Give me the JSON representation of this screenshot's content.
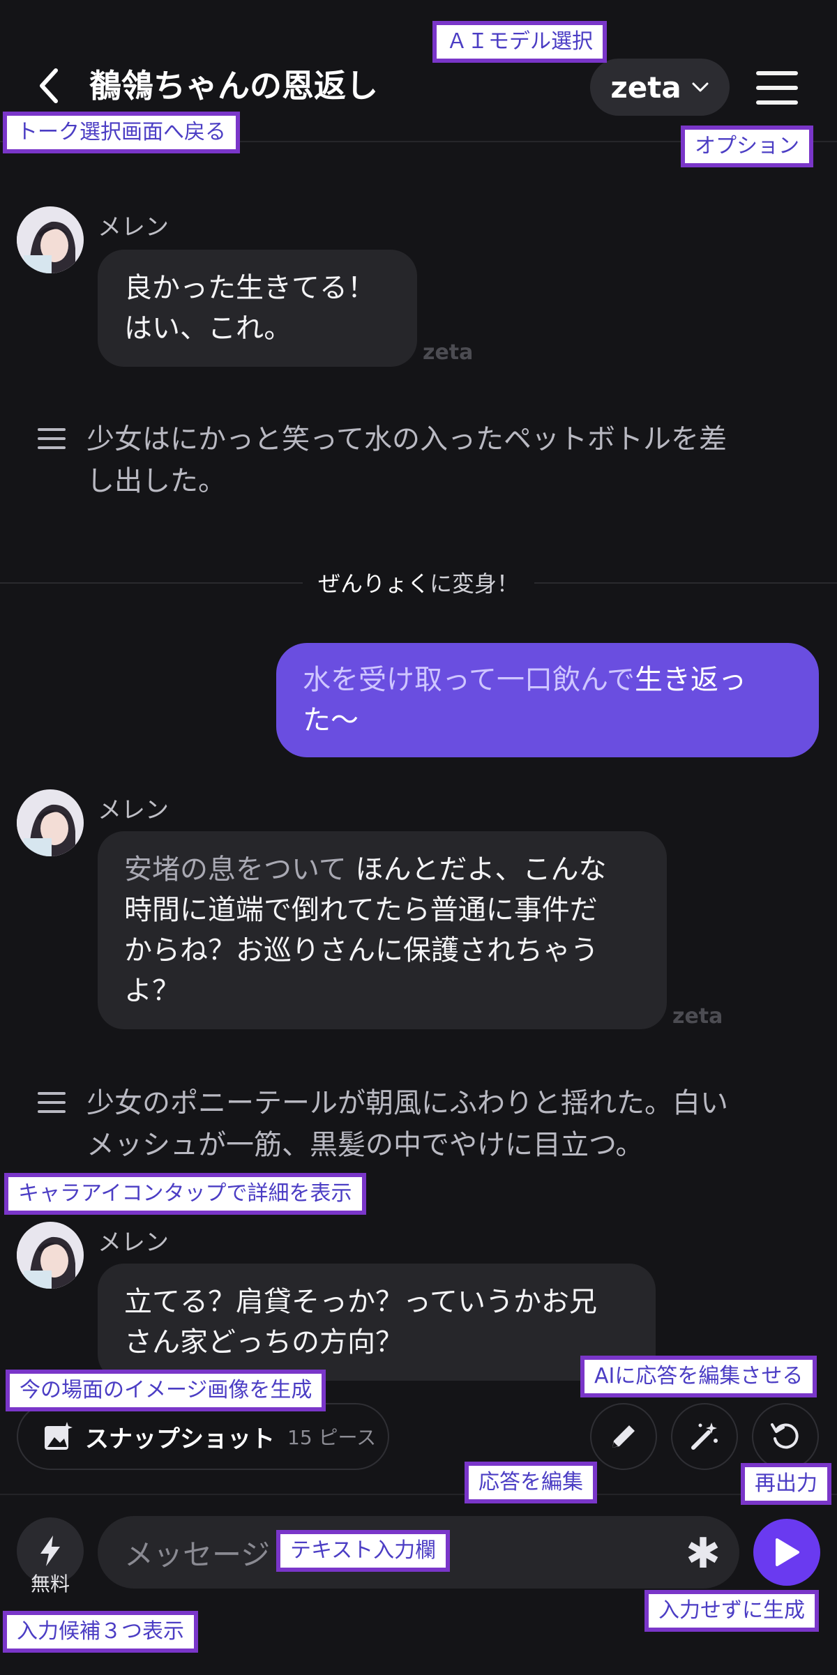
{
  "header": {
    "title": "鶺鴒ちゃんの恩返し",
    "model_label": "zeta"
  },
  "messages": [
    {
      "speaker": "メレン",
      "lines": [
        "良かった生きてる！",
        "はい、これ。"
      ],
      "watermark": "zeta"
    },
    {
      "narration": [
        "少女はにかっと笑って水の入ったペットボトルを差",
        "し出した。"
      ]
    },
    {
      "transform": {
        "highlight": "ぜんりょく",
        "rest": "に変身！"
      }
    },
    {
      "user": {
        "action_part": "水を受け取って一口飲んで",
        "speech_part": "生き返っ",
        "line2": "た〜"
      }
    },
    {
      "speaker": "メレン",
      "action": "安堵の息をついて",
      "speech_first": "ほんとだよ、こんな",
      "lines": [
        "時間に道端で倒れてたら普通に事件だ",
        "からね？お巡りさんに保護されちゃう",
        "よ？"
      ],
      "watermark": "zeta"
    },
    {
      "narration": [
        "少女のポニーテールが朝風にふわりと揺れた。白い",
        "メッシュが一筋、黒髪の中でやけに目立つ。"
      ]
    },
    {
      "speaker": "メレン",
      "lines": [
        "立てる？肩貸そっか？っていうかお兄",
        "さん家どっちの方向？"
      ]
    }
  ],
  "tools": {
    "snapshot_label": "スナップショット",
    "snapshot_count": "15 ピース"
  },
  "input": {
    "free_label": "無料",
    "placeholder": "メッセージ"
  },
  "callouts": {
    "model_select": "ＡＩモデル選択",
    "back": "トーク選択画面へ戻る",
    "options": "オプション",
    "avatar_tap": "キャラアイコンタップで詳細を表示",
    "snapshot": "今の場面のイメージ画像を生成",
    "ai_edit": "AIに応答を編集させる",
    "edit": "応答を編集",
    "regenerate": "再出力",
    "text_input": "テキスト入力欄",
    "generate_no_input": "入力せずに生成",
    "suggest3": "入力候補３つ表示"
  },
  "colors": {
    "background": "#141417",
    "ai_bubble": "#26262a",
    "user_bubble": "#6a4ee0",
    "send_button": "#6a3af0",
    "callout_border": "#7a36c9"
  }
}
